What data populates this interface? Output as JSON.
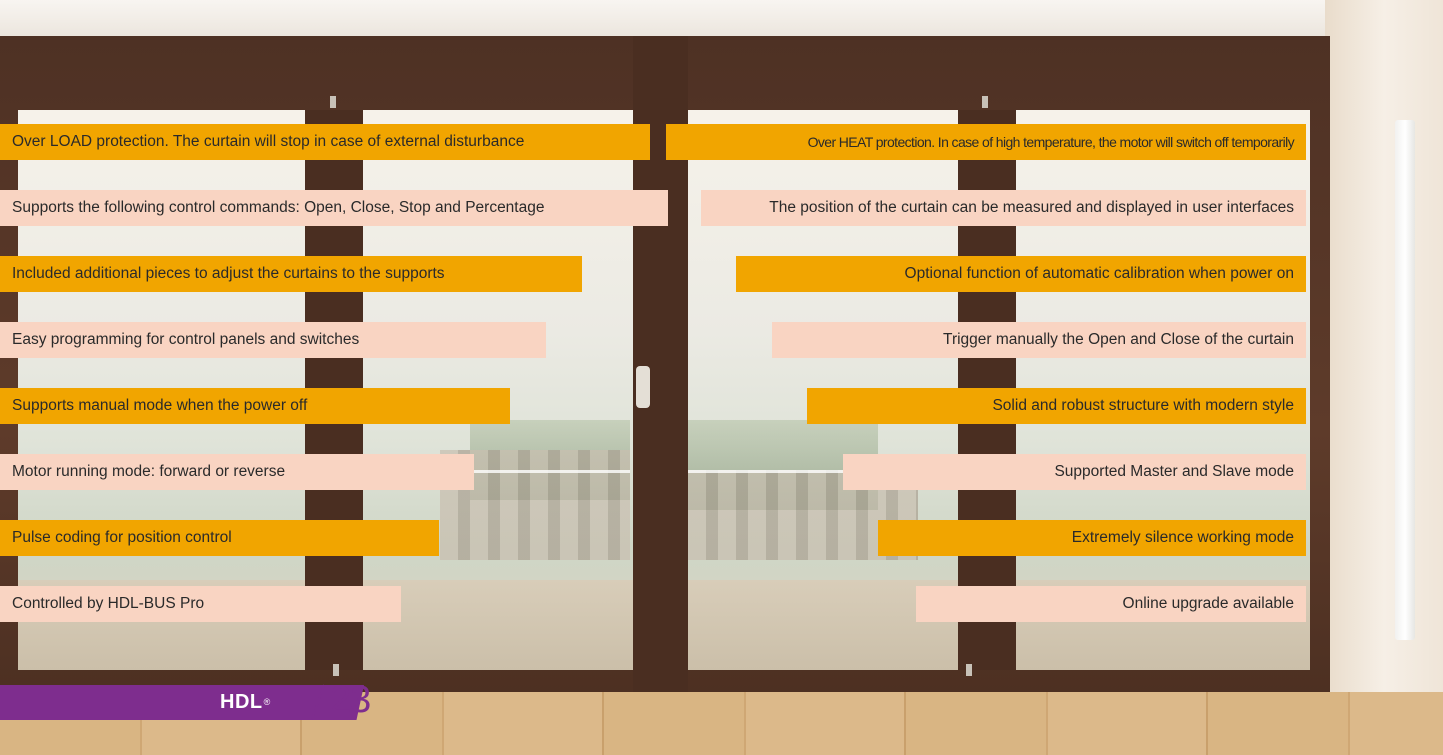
{
  "features_left": [
    {
      "text": "Over LOAD protection. The curtain will stop in case of external disturbance",
      "style": "orange"
    },
    {
      "text": "Supports the following control commands: Open, Close, Stop and Percentage",
      "style": "pink"
    },
    {
      "text": "Included additional pieces to adjust the curtains to the supports",
      "style": "orange"
    },
    {
      "text": "Easy programming for control panels and switches",
      "style": "pink"
    },
    {
      "text": "Supports manual mode when the power off",
      "style": "orange"
    },
    {
      "text": "Motor running mode: forward or reverse",
      "style": "pink"
    },
    {
      "text": "Pulse coding for position control",
      "style": "orange"
    },
    {
      "text": "Controlled by HDL-BUS Pro",
      "style": "pink"
    }
  ],
  "features_right": [
    {
      "text": "Over HEAT protection. In case of high temperature, the motor will switch off temporarily",
      "style": "orange"
    },
    {
      "text": "The position of the curtain can be measured and displayed in user interfaces",
      "style": "pink"
    },
    {
      "text": "Optional function of automatic calibration when power on",
      "style": "orange"
    },
    {
      "text": "Trigger manually the Open and Close of the curtain",
      "style": "pink"
    },
    {
      "text": "Solid and robust structure with modern style",
      "style": "orange"
    },
    {
      "text": "Supported Master and Slave mode",
      "style": "pink"
    },
    {
      "text": "Extremely silence working mode",
      "style": "orange"
    },
    {
      "text": "Online upgrade available",
      "style": "pink"
    }
  ],
  "footer": {
    "logo": "HDL",
    "logo_mark": "®",
    "page_number": "23"
  },
  "colors": {
    "orange_banner": "#f1a500",
    "pink_banner": "#f9d4c2",
    "brand_purple": "#7e2d8e"
  }
}
